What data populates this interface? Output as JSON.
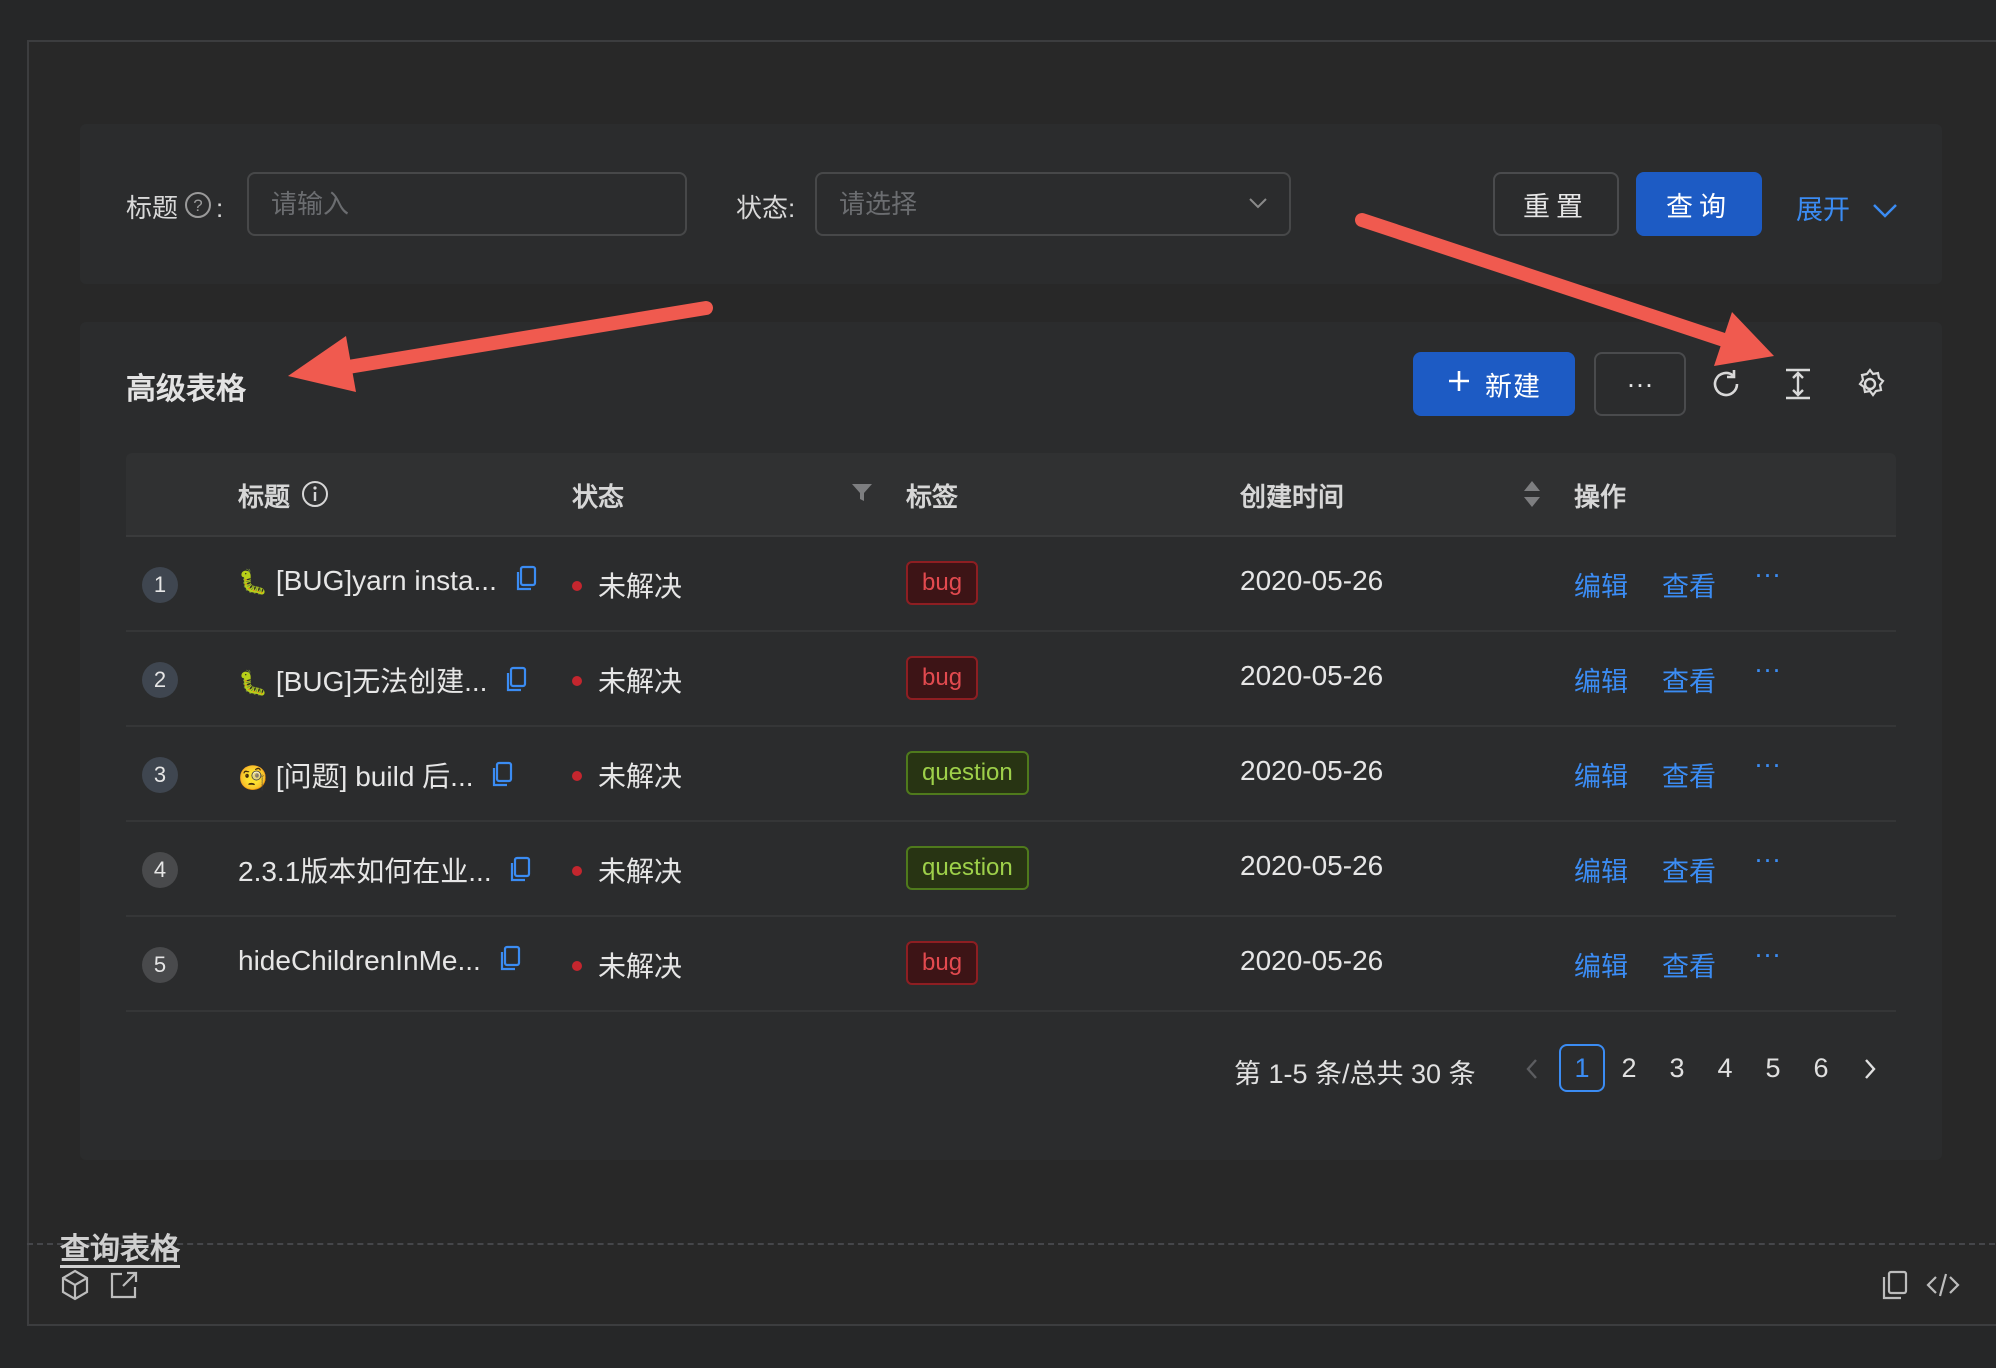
{
  "search": {
    "title_label": "标题",
    "title_colon": ":",
    "title_placeholder": "请输入",
    "status_label": "状态:",
    "status_placeholder": "请选择",
    "reset_label": "重置",
    "query_label": "查询",
    "expand_label": "展开"
  },
  "table": {
    "title": "高级表格",
    "new_button": "新建",
    "more_button": "···",
    "columns": {
      "title": "标题",
      "status": "状态",
      "tags": "标签",
      "created": "创建时间",
      "actions": "操作"
    },
    "rows": [
      {
        "index": "1",
        "title": "[BUG]yarn insta...",
        "emoji": "🐛",
        "status": "未解决",
        "tag": "bug",
        "created": "2020-05-26",
        "edit": "编辑",
        "view": "查看",
        "more": "···"
      },
      {
        "index": "2",
        "title": "[BUG]无法创建...",
        "emoji": "🐛",
        "status": "未解决",
        "tag": "bug",
        "created": "2020-05-26",
        "edit": "编辑",
        "view": "查看",
        "more": "···"
      },
      {
        "index": "3",
        "title": "[问题] build 后...",
        "emoji": "🧐",
        "status": "未解决",
        "tag": "question",
        "created": "2020-05-26",
        "edit": "编辑",
        "view": "查看",
        "more": "···"
      },
      {
        "index": "4",
        "title": "2.3.1版本如何在业...",
        "emoji": "",
        "status": "未解决",
        "tag": "question",
        "created": "2020-05-26",
        "edit": "编辑",
        "view": "查看",
        "more": "···"
      },
      {
        "index": "5",
        "title": "hideChildrenInMe...",
        "emoji": "",
        "status": "未解决",
        "tag": "bug",
        "created": "2020-05-26",
        "edit": "编辑",
        "view": "查看",
        "more": "···"
      }
    ],
    "pagination": {
      "summary": "第 1-5 条/总共 30 条",
      "pages": [
        "1",
        "2",
        "3",
        "4",
        "5",
        "6"
      ],
      "current": "1"
    }
  },
  "footer": {
    "title": "查询表格"
  },
  "colors": {
    "primary": "#1d5bc4",
    "link": "#3b8cf3",
    "arrow": "#f05a4f",
    "bug": "#e24a4f",
    "question": "#9ed04a"
  }
}
